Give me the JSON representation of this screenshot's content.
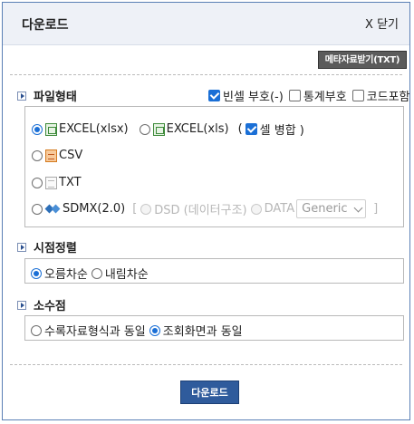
{
  "dialog": {
    "title": "다운로드",
    "close_label": "X 닫기",
    "meta_button": "메타자료받기(TXT)"
  },
  "file_type": {
    "section_label": "파일형태",
    "options": {
      "empty_cell_sign": {
        "label": "빈셀 부호(-)",
        "checked": true
      },
      "stat_sign": {
        "label": "통계부호",
        "checked": false
      },
      "include_code": {
        "label": "코드포함",
        "checked": false
      }
    },
    "formats": [
      {
        "label": "EXCEL(xlsx)",
        "selected": true
      },
      {
        "label": "EXCEL(xls)",
        "selected": false
      },
      {
        "label": "CSV",
        "selected": false
      },
      {
        "label": "TXT",
        "selected": false
      },
      {
        "label": "SDMX(2.0)",
        "selected": false
      }
    ],
    "merge_cells": {
      "label": "셀 병합 )",
      "prefix": "(",
      "checked": true
    },
    "sdmx": {
      "open_bracket": "[",
      "close_bracket": "]",
      "dsd_label": "DSD (데이터구조)",
      "data_label": "DATA",
      "data_select_value": "Generic"
    }
  },
  "time_sort": {
    "section_label": "시점정렬",
    "ascending": {
      "label": "오름차순",
      "selected": true
    },
    "descending": {
      "label": "내림차순",
      "selected": false
    }
  },
  "decimal": {
    "section_label": "소수점",
    "same_as_source": {
      "label": "수록자료형식과 동일",
      "selected": false
    },
    "same_as_screen": {
      "label": "조회화면과 동일",
      "selected": true
    }
  },
  "download_button": "다운로드",
  "colors": {
    "accent": "#1a6fd6",
    "primary_button": "#2f5b9c",
    "header_bg": "#eef1f7",
    "meta_button_bg": "#5b5b5b"
  }
}
